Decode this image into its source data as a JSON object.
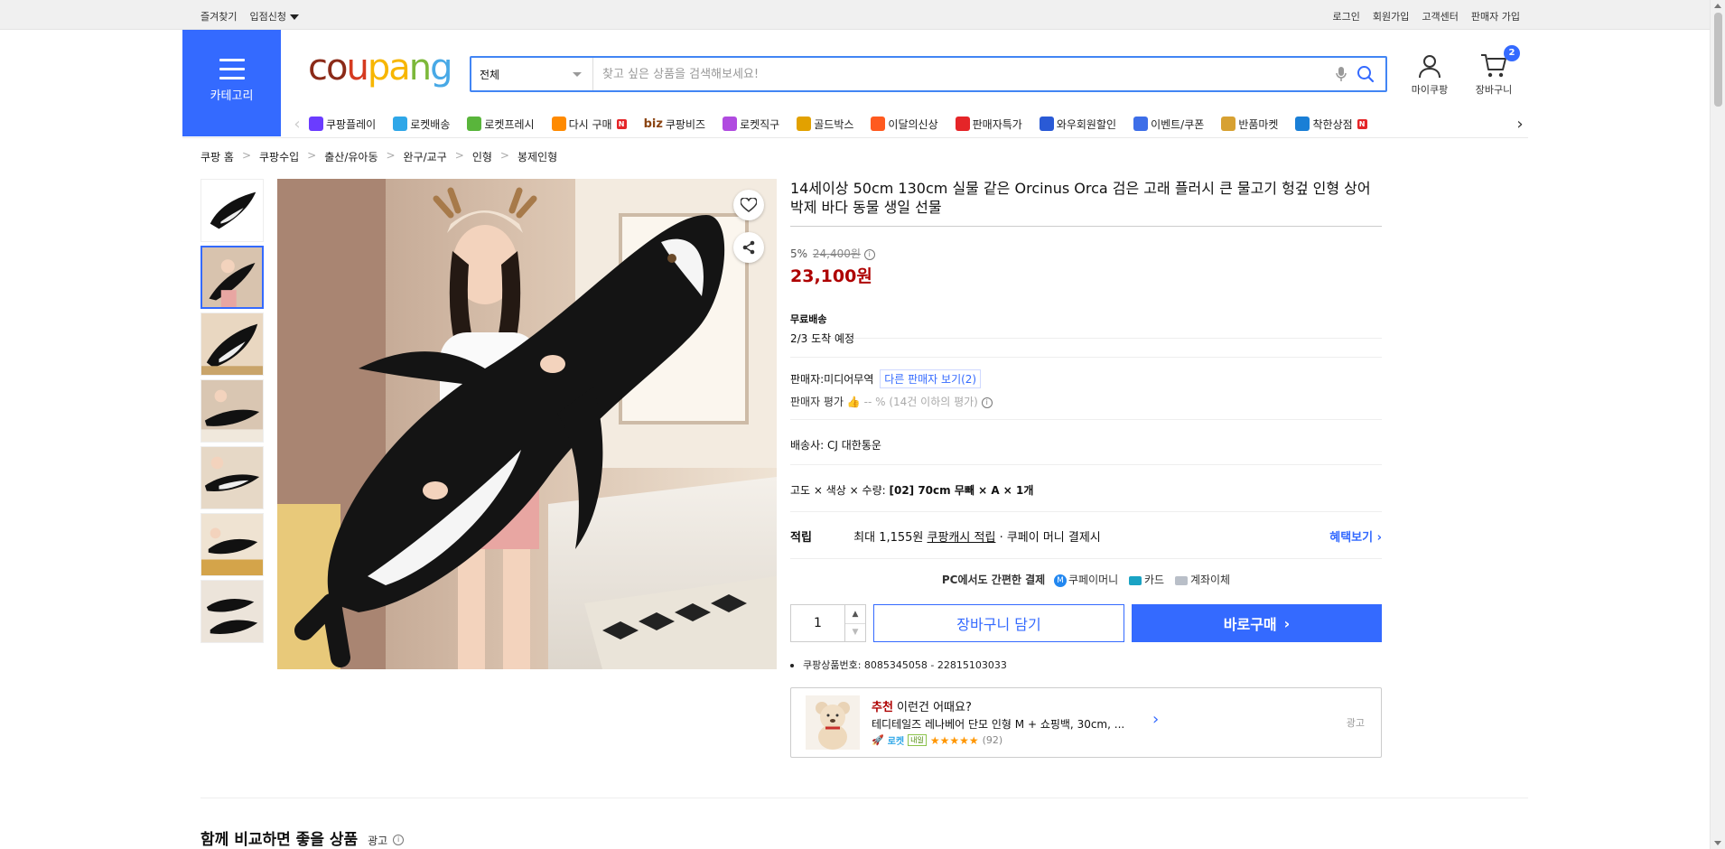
{
  "topbar": {
    "left": [
      "즐겨찾기",
      "입점신청"
    ],
    "right": [
      "로그인",
      "회원가입",
      "고객센터",
      "판매자 가입"
    ]
  },
  "header": {
    "category_label": "카테고리",
    "logo": {
      "c1": "co",
      "c2": "u",
      "c3": "pa",
      "c4": "n",
      "c5": "g"
    },
    "search_category": "전체",
    "search_placeholder": "찾고 싶은 상품을 검색해보세요!",
    "mypage_label": "마이쿠팡",
    "cart_label": "장바구니",
    "cart_count": "2"
  },
  "nav": {
    "items": [
      {
        "label": "쿠팡플레이",
        "color": "#6b3cff"
      },
      {
        "label": "로켓배송",
        "color": "#2fa7e8"
      },
      {
        "label": "로켓프레시",
        "color": "#59b53b"
      },
      {
        "label": "다시 구매",
        "color": "#ff8a00",
        "badge": "N"
      },
      {
        "label": "쿠팡비즈",
        "prefix": "biz",
        "color": "#8b4513"
      },
      {
        "label": "로켓직구",
        "color": "#b04be0"
      },
      {
        "label": "골드박스",
        "color": "#e2a100"
      },
      {
        "label": "이달의신상",
        "color": "#ff5a1f"
      },
      {
        "label": "판매자특가",
        "color": "#e52528"
      },
      {
        "label": "와우회원할인",
        "color": "#2a5ad6"
      },
      {
        "label": "이벤트/쿠폰",
        "color": "#3d6ee8"
      },
      {
        "label": "반품마켓",
        "color": "#d7a132"
      },
      {
        "label": "착한상점",
        "color": "#1a7fd6",
        "badge": "N"
      }
    ]
  },
  "breadcrumb": [
    "쿠팡 홈",
    "쿠팡수입",
    "출산/유아동",
    "완구/교구",
    "인형",
    "봉제인형"
  ],
  "product": {
    "title": "14세이상 50cm 130cm 실물 같은 Orcinus Orca 검은 고래 플러시 큰 물고기 헝겊 인형 상어 박제 바다 동물 생일 선물",
    "discount_rate": "5%",
    "original_price": "24,400원",
    "price": "23,100원",
    "shipping_title": "무료배송",
    "arrival": "2/3 도착 예정",
    "seller_label": "판매자:",
    "seller_name": "미디어무역",
    "other_sellers": "다른 판매자 보기(2)",
    "seller_rating_label": "판매자 평가",
    "seller_rating_value": "-- %",
    "seller_rating_note": "(14건 이하의 평가)",
    "carrier_label": "배송사:",
    "carrier_name": "CJ 대한통운",
    "option_label": "고도 × 색상 × 수량:",
    "option_value": "[02] 70cm 무빼 × A × 1개",
    "points_label": "적립",
    "points_prefix": "최대 1,155원",
    "points_link": "쿠팡캐시 적립",
    "points_suffix": "· 쿠페이 머니 결제시",
    "benefit_link": "혜택보기",
    "pay_title": "PC에서도 간편한 결제",
    "pay_money": "쿠페이머니",
    "pay_card": "카드",
    "pay_bank": "계좌이체",
    "quantity": "1",
    "add_to_cart": "장바구니 담기",
    "buy_now": "바로구매",
    "product_id": "쿠팡상품번호: 8085345058 - 22815103033"
  },
  "recommend": {
    "title_red": "추천",
    "title_rest": " 이런건 어때요?",
    "name": "테디테일즈 레나베어 단모 인형 M + 쇼핑백, 30cm, ...",
    "rocket": "로켓",
    "tag": "내일",
    "stars": "★★★★★",
    "count": "(92)",
    "ad": "광고"
  },
  "compare": {
    "title": "함께 비교하면 좋을 상품",
    "ad": "광고"
  },
  "colors": {
    "accent": "#346aff",
    "price": "#ae0000"
  }
}
